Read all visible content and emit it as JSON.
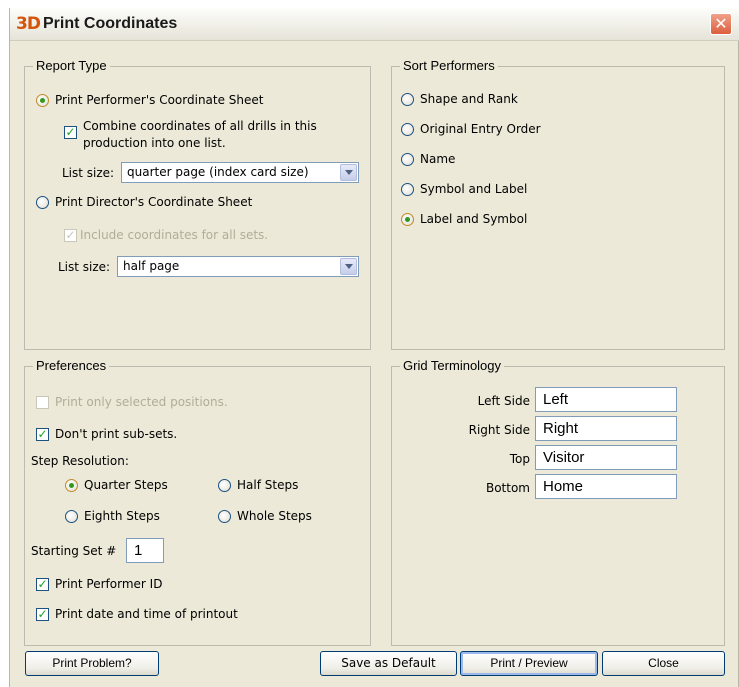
{
  "window": {
    "icon_text": "3D",
    "title": "Print Coordinates",
    "close_glyph": "✕"
  },
  "report_type": {
    "legend": "Report Type",
    "performer_sheet_label": "Print Performer's Coordinate Sheet",
    "performer_sheet_selected": true,
    "combine_label_line1": "Combine coordinates of all drills in this",
    "combine_label_line2": "production into one list.",
    "combine_checked": true,
    "list_size_label": "List size:",
    "performer_list_size": "quarter page (index card size)",
    "director_sheet_label": "Print Director's Coordinate Sheet",
    "director_sheet_selected": false,
    "include_all_sets_label": "Include coordinates for all sets.",
    "include_all_sets_checked": true,
    "include_all_sets_enabled": false,
    "director_list_size": "half page"
  },
  "sort_performers": {
    "legend": "Sort Performers",
    "options": [
      {
        "label": "Shape and Rank",
        "selected": false
      },
      {
        "label": "Original Entry Order",
        "selected": false
      },
      {
        "label": "Name",
        "selected": false
      },
      {
        "label": "Symbol and Label",
        "selected": false
      },
      {
        "label": "Label and Symbol",
        "selected": true
      }
    ]
  },
  "preferences": {
    "legend": "Preferences",
    "selected_only_label": "Print only selected positions.",
    "selected_only_checked": false,
    "selected_only_enabled": false,
    "no_subsets_label": "Don't print sub-sets.",
    "no_subsets_checked": true,
    "step_resolution_label": "Step Resolution:",
    "steps": {
      "quarter": {
        "label": "Quarter Steps",
        "selected": true
      },
      "half": {
        "label": "Half Steps",
        "selected": false
      },
      "eighth": {
        "label": "Eighth Steps",
        "selected": false
      },
      "whole": {
        "label": "Whole Steps",
        "selected": false
      }
    },
    "starting_set_label": "Starting Set #",
    "starting_set_value": "1",
    "performer_id_label": "Print Performer ID",
    "performer_id_checked": true,
    "date_time_label": "Print date and time of printout",
    "date_time_checked": true
  },
  "grid_terminology": {
    "legend": "Grid Terminology",
    "left_label": "Left Side",
    "left_value": "Left",
    "right_label": "Right Side",
    "right_value": "Right",
    "top_label": "Top",
    "top_value": "Visitor",
    "bottom_label": "Bottom",
    "bottom_value": "Home"
  },
  "buttons": {
    "problem": "Print Problem?",
    "save_default": "Save as Default",
    "print_preview": "Print / Preview",
    "close": "Close"
  },
  "check_glyph": "✓"
}
